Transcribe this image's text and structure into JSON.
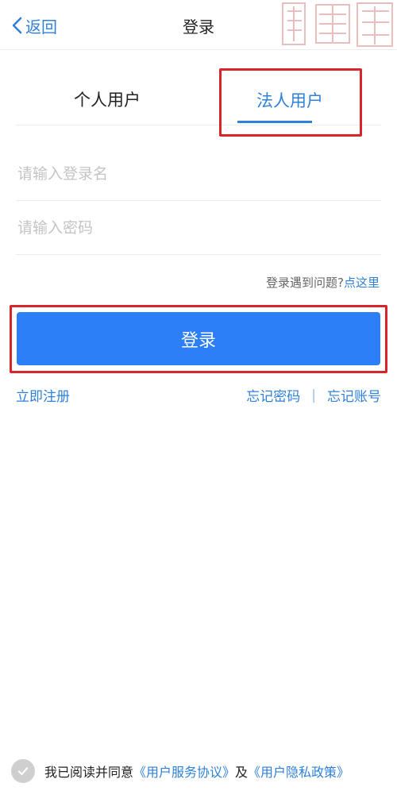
{
  "nav": {
    "back_label": "返回",
    "title": "登录"
  },
  "tabs": [
    {
      "label": "个人用户"
    },
    {
      "label": "法人用户"
    }
  ],
  "fields": {
    "username_placeholder": "请输入登录名",
    "password_placeholder": "请输入密码",
    "username_value": "",
    "password_value": ""
  },
  "help": {
    "prefix": "登录遇到问题?",
    "link": "点这里"
  },
  "login_button": "登录",
  "links": {
    "register": "立即注册",
    "forgot_password": "忘记密码",
    "separator": "|",
    "forgot_account": "忘记账号"
  },
  "agreement": {
    "prefix": "我已阅读并同意",
    "service_link": "《用户服务协议》",
    "conjunction": "及",
    "privacy_link": "《用户隐私政策》"
  },
  "colors": {
    "accent": "#2f80d8",
    "button": "#2c7ff7",
    "highlight": "#d6262b"
  },
  "icons": {
    "back": "chevron-left-icon",
    "check": "check-circle-icon",
    "watermark": "seal-watermark"
  }
}
